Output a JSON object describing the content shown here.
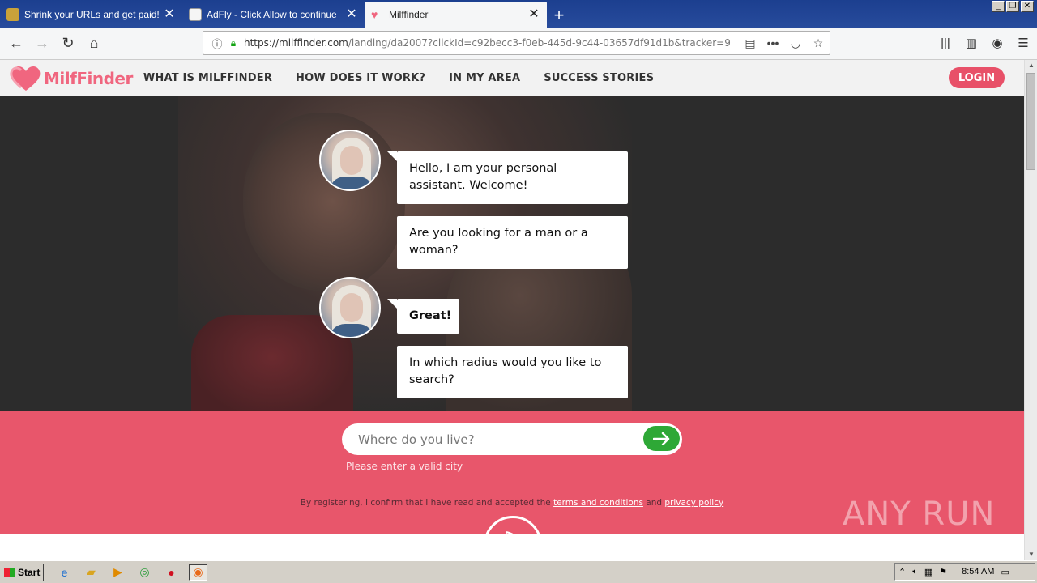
{
  "browser": {
    "tabs": [
      {
        "title": "Shrink your URLs and get paid!",
        "active": false
      },
      {
        "title": "AdFly - Click Allow to continue",
        "active": false
      },
      {
        "title": "Milffinder",
        "active": true
      }
    ],
    "url_host": "https://milffinder.com",
    "url_path": "/landing/da2007?clickId=c92becc3-f0eb-445d-9c44-03657df91d1b&tracker=9"
  },
  "site": {
    "logo_text": "MilfFinder",
    "nav": [
      "WHAT IS MILFFINDER",
      "HOW DOES IT WORK?",
      "IN MY AREA",
      "SUCCESS STORIES"
    ],
    "login_label": "LOGIN",
    "accent_color": "#e8566b"
  },
  "chat": {
    "msg1": "Hello, I am your personal assistant. Welcome!",
    "msg2": "Are you looking for a man or a woman?",
    "msg3": "Great!",
    "msg4": "In which radius would you like to search?"
  },
  "form": {
    "city_placeholder": "Where do you live?",
    "error": "Please enter a valid city",
    "legal_prefix": "By registering, I confirm that I have read and accepted the",
    "terms_link": "terms and conditions",
    "and": "and",
    "privacy_link": "privacy policy"
  },
  "watermark": "ANY RUN",
  "taskbar": {
    "start_label": "Start",
    "clock": "8:54 AM"
  }
}
